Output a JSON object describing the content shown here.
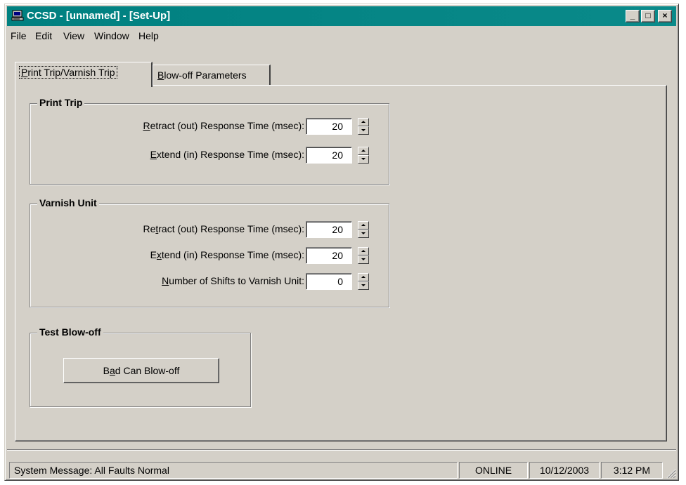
{
  "window": {
    "title": "CCSD - [unnamed] - [Set-Up]",
    "controls": {
      "minimize": "_",
      "maximize": "□",
      "close": "×"
    },
    "icon": "computer-icon"
  },
  "menu": {
    "items": [
      {
        "label": "File"
      },
      {
        "label": "Edit"
      },
      {
        "label": "View"
      },
      {
        "label": "Window"
      },
      {
        "label": "Help"
      }
    ]
  },
  "tabs": [
    {
      "pre": "",
      "key": "P",
      "post": "rint Trip/Varnish Trip",
      "active": true
    },
    {
      "pre": "",
      "key": "B",
      "post": "low-off Parameters",
      "active": false
    }
  ],
  "print_trip": {
    "title": "Print Trip",
    "retract": {
      "pre": "",
      "key": "R",
      "post": "etract (out) Response Time (msec):",
      "value": "20"
    },
    "extend": {
      "pre": "",
      "key": "E",
      "post": "xtend (in) Response Time (msec):",
      "value": "20"
    }
  },
  "varnish_unit": {
    "title": "Varnish Unit",
    "retract": {
      "pre": "Re",
      "key": "t",
      "post": "ract (out) Response Time (msec):",
      "value": "20"
    },
    "extend": {
      "pre": "E",
      "key": "x",
      "post": "tend (in) Response Time (msec):",
      "value": "20"
    },
    "shifts": {
      "pre": "",
      "key": "N",
      "post": "umber of Shifts to Varnish Unit:",
      "value": "0"
    }
  },
  "test_blowoff": {
    "title": "Test Blow-off",
    "button": {
      "pre": "B",
      "key": "a",
      "post": "d Can Blow-off"
    }
  },
  "status": {
    "message": "System Message:  All Faults Normal",
    "online": "ONLINE",
    "date": "10/12/2003",
    "time": "3:12 PM"
  },
  "colors": {
    "title_bar": "#008080",
    "face": "#d4d0c8",
    "field": "#ffffff"
  }
}
